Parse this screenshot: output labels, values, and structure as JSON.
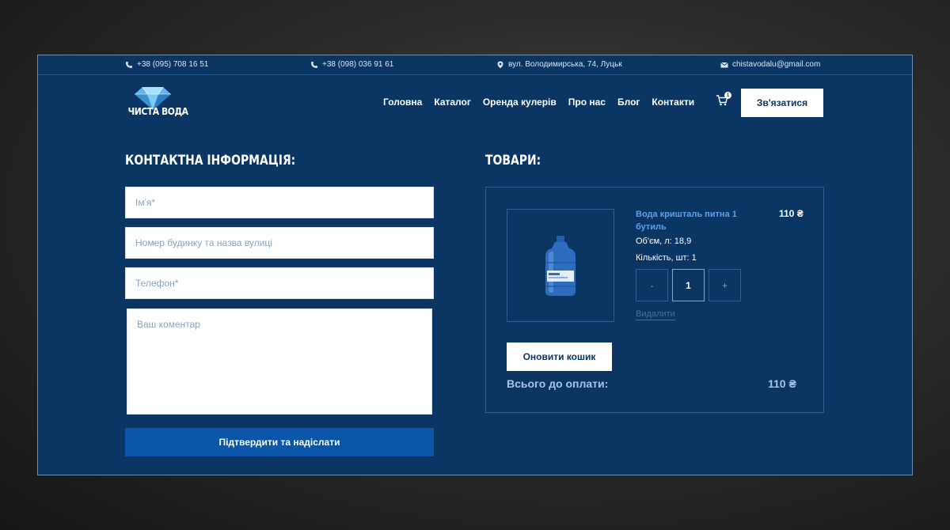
{
  "topbar": {
    "phone1": "+38 (095) 708 16 51",
    "phone2": "+38 (098) 036 91 61",
    "address": "вул. Володимирська, 74, Луцьк",
    "email": "chistavodalu@gmail.com"
  },
  "brand": {
    "logo_text": "ЧИСТА ВОДА"
  },
  "nav": {
    "items": [
      "Головна",
      "Каталог",
      "Оренда кулерів",
      "Про нас",
      "Блог",
      "Контакти"
    ],
    "cart_count": "1",
    "contact_button": "Зв'язатися"
  },
  "form": {
    "title": "КОНТАКТНА ІНФОРМАЦІЯ:",
    "name_placeholder": "Ім'я*",
    "address_placeholder": "Номер будинку та назва вулиці",
    "phone_placeholder": "Телефон*",
    "comment_placeholder": "Ваш коментар",
    "submit_label": "Підтвердити та надіслати"
  },
  "cart": {
    "title": "ТОВАРИ:",
    "product": {
      "name": "Вода кришталь питна 1 бутиль",
      "price": "110 ₴",
      "volume_label": "Об'єм, л:",
      "volume_value": "18,9",
      "quantity_label": "Кількість, шт:",
      "quantity_value": "1",
      "minus": "-",
      "qty_input": "1",
      "plus": "+",
      "remove_label": "Видалити"
    },
    "update_button": "Оновити кошик",
    "total_label": "Всього до оплати:",
    "total_value": "110 ₴"
  },
  "colors": {
    "panel_bg": "#0b3664",
    "accent_blue": "#0a56a8",
    "link_blue": "#5ea0ea",
    "white": "#ffffff"
  }
}
